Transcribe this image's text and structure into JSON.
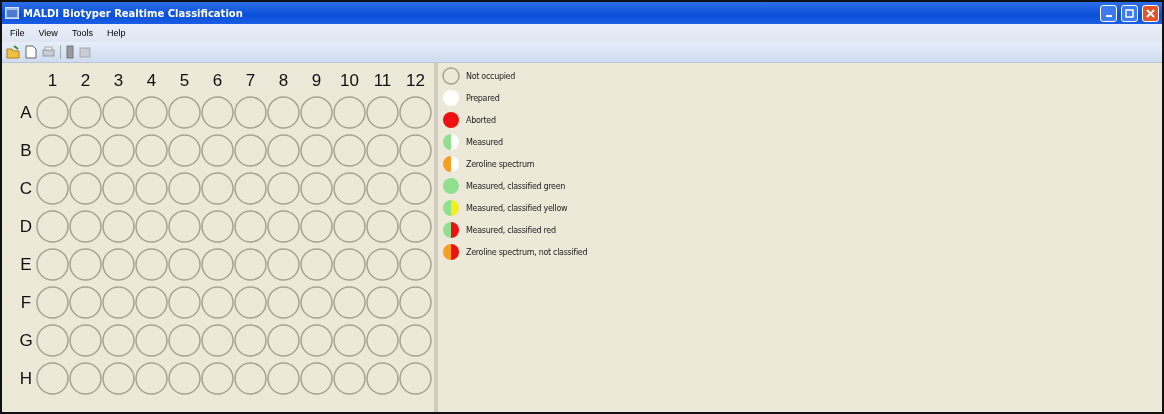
{
  "window": {
    "title": "MALDI Biotyper Realtime Classification"
  },
  "menu": [
    "File",
    "View",
    "Tools",
    "Help"
  ],
  "plate": {
    "columns": [
      "1",
      "2",
      "3",
      "4",
      "5",
      "6",
      "7",
      "8",
      "9",
      "10",
      "11",
      "12"
    ],
    "rows": [
      {
        "label": "A",
        "wells": [
          {
            "kind": "empty"
          },
          {
            "kind": "empty"
          },
          {
            "kind": "empty"
          },
          {
            "kind": "empty"
          },
          {
            "kind": "empty"
          },
          {
            "kind": "empty"
          },
          {
            "kind": "empty"
          },
          {
            "kind": "empty"
          },
          {
            "kind": "empty"
          },
          {
            "kind": "empty"
          },
          {
            "kind": "empty"
          },
          {
            "kind": "empty"
          }
        ]
      },
      {
        "label": "B",
        "wells": [
          {
            "kind": "empty"
          },
          {
            "kind": "empty"
          },
          {
            "kind": "empty"
          },
          {
            "kind": "empty"
          },
          {
            "kind": "empty"
          },
          {
            "kind": "empty"
          },
          {
            "kind": "empty"
          },
          {
            "kind": "empty"
          },
          {
            "kind": "empty"
          },
          {
            "kind": "empty"
          },
          {
            "kind": "empty"
          },
          {
            "kind": "empty"
          }
        ]
      },
      {
        "label": "C",
        "wells": [
          {
            "kind": "empty"
          },
          {
            "kind": "empty"
          },
          {
            "kind": "empty"
          },
          {
            "kind": "empty"
          },
          {
            "kind": "empty"
          },
          {
            "kind": "empty"
          },
          {
            "kind": "empty"
          },
          {
            "kind": "empty"
          },
          {
            "kind": "empty"
          },
          {
            "kind": "empty"
          },
          {
            "kind": "empty"
          },
          {
            "kind": "empty"
          }
        ]
      },
      {
        "label": "D",
        "wells": [
          {
            "kind": "empty"
          },
          {
            "kind": "empty"
          },
          {
            "kind": "empty"
          },
          {
            "kind": "empty"
          },
          {
            "kind": "empty"
          },
          {
            "kind": "empty"
          },
          {
            "kind": "empty"
          },
          {
            "kind": "empty"
          },
          {
            "kind": "empty"
          },
          {
            "kind": "empty"
          },
          {
            "kind": "empty"
          },
          {
            "kind": "empty"
          }
        ]
      },
      {
        "label": "E",
        "wells": [
          {
            "kind": "empty"
          },
          {
            "kind": "empty"
          },
          {
            "kind": "empty"
          },
          {
            "kind": "empty"
          },
          {
            "kind": "empty"
          },
          {
            "kind": "empty"
          },
          {
            "kind": "empty"
          },
          {
            "kind": "empty"
          },
          {
            "kind": "empty"
          },
          {
            "kind": "empty"
          },
          {
            "kind": "empty"
          },
          {
            "kind": "empty"
          }
        ]
      },
      {
        "label": "F",
        "wells": [
          {
            "kind": "empty"
          },
          {
            "kind": "empty"
          },
          {
            "kind": "empty"
          },
          {
            "kind": "empty"
          },
          {
            "kind": "empty"
          },
          {
            "kind": "empty"
          },
          {
            "kind": "empty"
          },
          {
            "kind": "empty"
          },
          {
            "kind": "empty"
          },
          {
            "kind": "empty"
          },
          {
            "kind": "empty"
          },
          {
            "kind": "empty"
          }
        ]
      },
      {
        "label": "G",
        "wells": [
          {
            "kind": "empty"
          },
          {
            "kind": "empty"
          },
          {
            "kind": "empty"
          },
          {
            "kind": "empty"
          },
          {
            "kind": "empty"
          },
          {
            "kind": "empty"
          },
          {
            "kind": "empty"
          },
          {
            "kind": "empty"
          },
          {
            "kind": "empty"
          },
          {
            "kind": "empty"
          },
          {
            "kind": "empty"
          },
          {
            "kind": "empty"
          }
        ]
      },
      {
        "label": "H",
        "wells": [
          {
            "kind": "empty"
          },
          {
            "kind": "empty"
          },
          {
            "kind": "empty"
          },
          {
            "kind": "empty"
          },
          {
            "kind": "empty"
          },
          {
            "kind": "empty"
          },
          {
            "kind": "empty"
          },
          {
            "kind": "empty"
          },
          {
            "kind": "empty"
          },
          {
            "kind": "empty"
          },
          {
            "kind": "empty"
          },
          {
            "kind": "empty"
          }
        ]
      }
    ]
  },
  "legend": [
    {
      "label": "Not occupied",
      "kind": "empty"
    },
    {
      "label": "Prepared",
      "kind": "full",
      "color": "#ffffff"
    },
    {
      "label": "Aborted",
      "kind": "full",
      "color": "#ee1111"
    },
    {
      "label": "Measured",
      "kind": "half",
      "halves": [
        {
          "color": "#90e090"
        },
        {
          "color": "#ffffff"
        }
      ]
    },
    {
      "label": "Zeroline spectrum",
      "kind": "half",
      "halves": [
        {
          "color": "#f5a020"
        },
        {
          "color": "#ffffff"
        }
      ]
    },
    {
      "label": "Measured, classified green",
      "kind": "full",
      "color": "#90e090"
    },
    {
      "label": "Measured, classified yellow",
      "kind": "half",
      "halves": [
        {
          "color": "#90e090"
        },
        {
          "color": "#f0f020"
        }
      ]
    },
    {
      "label": "Measured, classified red",
      "kind": "half",
      "halves": [
        {
          "color": "#90e090"
        },
        {
          "color": "#ee1111"
        }
      ]
    },
    {
      "label": "Zeroline spectrum, not classified",
      "kind": "half",
      "halves": [
        {
          "color": "#f5a020"
        },
        {
          "color": "#ee1111"
        }
      ]
    }
  ]
}
